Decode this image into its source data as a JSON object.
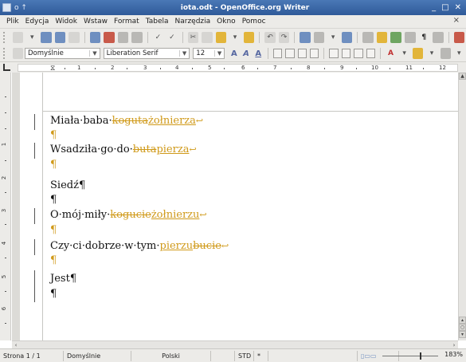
{
  "window": {
    "title": "iota.odt - OpenOffice.org Writer",
    "controls": [
      "_",
      "□",
      "✕"
    ]
  },
  "menu": [
    "Plik",
    "Edycja",
    "Widok",
    "Wstaw",
    "Format",
    "Tabela",
    "Narzędzia",
    "Okno",
    "Pomoc"
  ],
  "toolbar2": {
    "style": "Domyślnie",
    "font": "Liberation Serif",
    "size": "12"
  },
  "ruler": {
    "numbers": [
      "1",
      "2",
      "3",
      "4",
      "5",
      "6",
      "7",
      "8",
      "9",
      "10",
      "11",
      "12"
    ]
  },
  "vruler": {
    "numbers": [
      "1",
      "2",
      "3",
      "4",
      "5",
      "6"
    ]
  },
  "document": {
    "line1": {
      "pre": "Miała·baba·",
      "del": "koguta",
      "ins": "żołnierza",
      "mark": "↩"
    },
    "line2": {
      "pre": "Wsadziła·go·do·",
      "del": "buta",
      "ins": "pierza",
      "mark": "↩"
    },
    "line3": {
      "text": "Siedź"
    },
    "line4": {
      "pre": "O·mój·miły·",
      "del": "kogucie",
      "ins": "żołnierzu",
      "mark": "↩"
    },
    "line5": {
      "pre": "Czy·ci·dobrze·w·tym·",
      "ins": "pierzu",
      "del": "bucie",
      "mark": "↩"
    },
    "line6": {
      "text": "Jest"
    },
    "pilcrow": "¶"
  },
  "status": {
    "page": "Strona 1 / 1",
    "style": "Domyślnie",
    "lang": "Polski",
    "mode": "STD",
    "star": "*",
    "zoom": "183%"
  }
}
